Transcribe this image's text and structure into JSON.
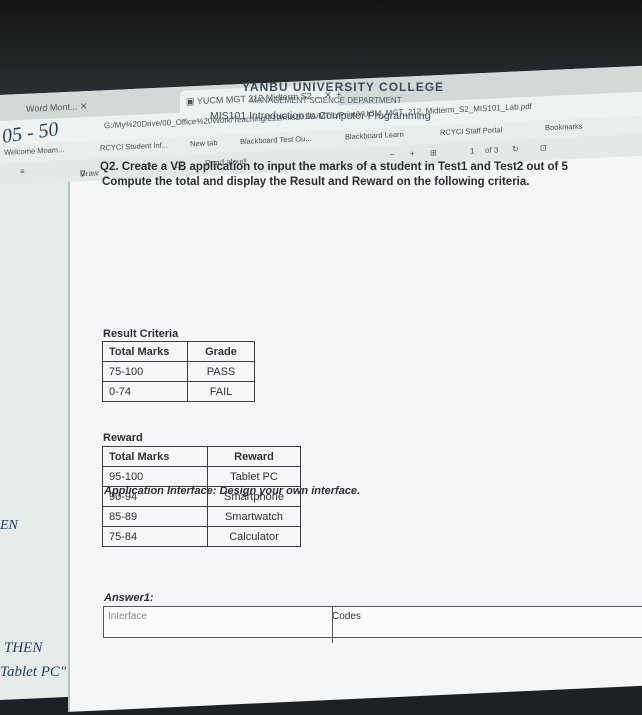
{
  "browser": {
    "tabs": [
      {
        "label": "Word Mont..."
      },
      {
        "label": "YUCM MGT 212 Midterm S2 ..."
      }
    ],
    "url": "G:/My%20Drive/00_Office%20Work/Teaching/212/mis101/A/MT/L/Print/YUCM_MGT_212_Midterm_S2_MIS101_Lab.pdf",
    "bookmarks": [
      "Welcome Moam...",
      "RCYCI Student Inf...",
      "New tab",
      "Blackboard Test Ou...",
      "Blackboard Learn",
      "RCYCI Staff Portal",
      "Bookmarks"
    ],
    "pdf_toolbar": {
      "draw": "Draw",
      "read_aloud": "Read aloud",
      "page_current": "1",
      "page_total": "of 3"
    }
  },
  "document": {
    "college": "YANBU UNIVERSITY COLLEGE",
    "department": "MANAGEMENT SCIENCE DEPARTMENT",
    "course": "MIS101 Introduction to Computer Programming",
    "question": "Q2. Create a VB application to input the marks of a student in Test1 and Test2 out of 5",
    "question_line2": "Compute the total and display the Result and Reward on the following criteria.",
    "result_title": "Result Criteria",
    "result_headers": [
      "Total Marks",
      "Grade"
    ],
    "result_rows": [
      [
        "75-100",
        "PASS"
      ],
      [
        "0-74",
        "FAIL"
      ]
    ],
    "reward_title": "Reward",
    "reward_headers": [
      "Total Marks",
      "Reward"
    ],
    "reward_rows": [
      [
        "95-100",
        "Tablet PC"
      ],
      [
        "90-94",
        "Smartphone"
      ],
      [
        "85-89",
        "Smartwatch"
      ],
      [
        "75-84",
        "Calculator"
      ]
    ],
    "interface_note": "Application Interface: Design your own interface.",
    "answer_label": "Answer1:",
    "answer_col1": "Interface",
    "answer_col2": "Codes"
  },
  "handwriting": {
    "score": "05 - 50",
    "en": "EN",
    "then": "THEN",
    "tablet": "Tablet PC\""
  },
  "colors": {
    "page": "#f4f7f5",
    "ink": "#263f6a",
    "text": "#2b2d33"
  }
}
